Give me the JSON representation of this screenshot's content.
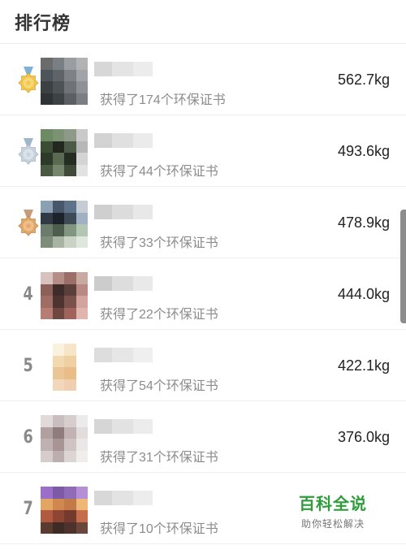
{
  "header": {
    "title": "排行榜"
  },
  "rows": [
    {
      "rank": "",
      "medal": "gold",
      "sub": "获得了174个环保证书",
      "weight": "562.7kg",
      "avatar": [
        "#6b6b6b",
        "#7a7f84",
        "#9a9da2",
        "#b3b3b3",
        "#4e555a",
        "#5e6468",
        "#7e8286",
        "#a0a3a7",
        "#3c4043",
        "#4d5255",
        "#6f7378",
        "#8e9296",
        "#2f3336",
        "#3d4245",
        "#5b6064",
        "#7b7f84"
      ],
      "name": [
        "#d7d7d7",
        "#e4e4e4",
        "#ececec"
      ]
    },
    {
      "rank": "",
      "medal": "silver",
      "sub": "获得了44个环保证书",
      "weight": "493.6kg",
      "avatar": [
        "#6e8a65",
        "#7b9372",
        "#8e9a88",
        "#c9c9c9",
        "#3b4e35",
        "#22281f",
        "#4b5b45",
        "#b7b7b7",
        "#2e3a29",
        "#5b6b52",
        "#262b23",
        "#d4d4d4",
        "#4a5a42",
        "#76866d",
        "#3f4a3a",
        "#e2e2e2"
      ],
      "name": [
        "#d2d2d2",
        "#e0e0e0",
        "#ebebeb"
      ]
    },
    {
      "rank": "",
      "medal": "bronze",
      "sub": "获得了33个环保证书",
      "weight": "478.9kg",
      "avatar": [
        "#8aa1b3",
        "#465769",
        "#5d7389",
        "#c5ccd3",
        "#2f3a44",
        "#1c232a",
        "#3e4b57",
        "#9fb1c2",
        "#6b7c6c",
        "#4d5e4f",
        "#80967f",
        "#b2c6b3",
        "#7e8d7a",
        "#a8b3a4",
        "#c8d2c5",
        "#dfe6dd"
      ],
      "name": [
        "#cfcfcf",
        "#dcdcdc",
        "#e8e8e8"
      ]
    },
    {
      "rank": "4",
      "medal": "",
      "sub": "获得了22个环保证书",
      "weight": "444.0kg",
      "avatar": [
        "#d7c2bd",
        "#b58d86",
        "#9b6f67",
        "#c9aaa3",
        "#8c5f58",
        "#3d2c2a",
        "#5b3f3b",
        "#b88a82",
        "#a06d65",
        "#4c3431",
        "#7a514b",
        "#d2a49c",
        "#b77d74",
        "#6e4741",
        "#a0625a",
        "#e0b5ad"
      ],
      "name": [
        "#cccccc",
        "#dddddd",
        "#e9e9e9"
      ]
    },
    {
      "rank": "5",
      "medal": "",
      "sub": "获得了54个环保证书",
      "weight": "422.1kg",
      "avatar": [
        "#ffffff",
        "#fbf1df",
        "#f6e5c7",
        "#ffffff",
        "#ffffff",
        "#f3d9b0",
        "#efd0a2",
        "#ffffff",
        "#ffffff",
        "#ecc595",
        "#e9bd88",
        "#ffffff",
        "#ffffff",
        "#f3d7ba",
        "#f0cfb0",
        "#ffffff"
      ],
      "name": [
        "#dddddd",
        "#e6e6e6",
        "#efefef"
      ]
    },
    {
      "rank": "6",
      "medal": "",
      "sub": "获得了31个环保证书",
      "weight": "376.0kg",
      "avatar": [
        "#e0dada",
        "#c9bdbd",
        "#d8cdcd",
        "#ecebeb",
        "#b29f9f",
        "#8f7c7c",
        "#c1b3b3",
        "#e2dcdc",
        "#bfb1b1",
        "#a99494",
        "#cfc4c4",
        "#ece7e7",
        "#d6cccc",
        "#bcaeae",
        "#ddd4d4",
        "#f1eded"
      ],
      "name": [
        "#d6d6d6",
        "#e2e2e2",
        "#ececec"
      ]
    },
    {
      "rank": "7",
      "medal": "",
      "sub": "获得了10个环保证书",
      "weight": "",
      "avatar": [
        "#9b6fc9",
        "#7d5aa6",
        "#8f6bb8",
        "#b58fd6",
        "#e2a562",
        "#d08850",
        "#c27a47",
        "#edb777",
        "#b05b3f",
        "#8e4633",
        "#743a2d",
        "#c46e4b",
        "#5b3a30",
        "#3f2b26",
        "#4d332c",
        "#6b463a"
      ],
      "name": [
        "#d8d8d8",
        "#e3e3e3",
        "#ededed"
      ]
    }
  ],
  "watermark": {
    "title": "百科全说",
    "subtitle": "助你轻松解决"
  }
}
